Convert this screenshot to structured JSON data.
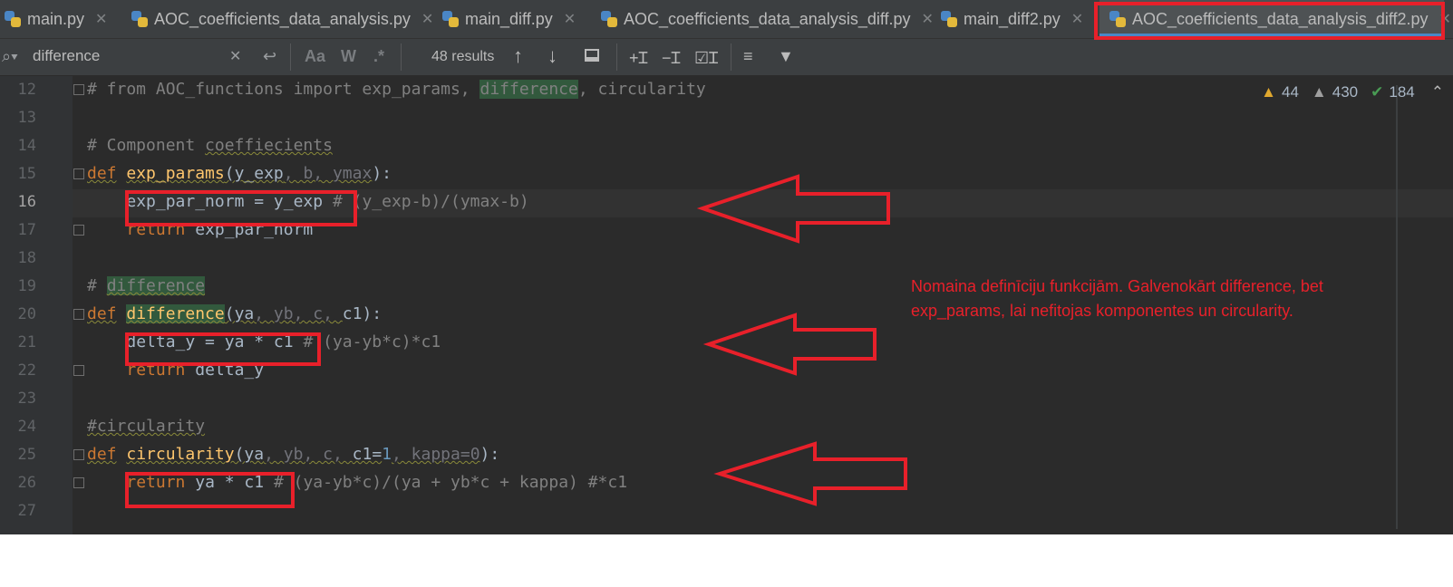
{
  "tabs": [
    {
      "label": "main.py",
      "active": false
    },
    {
      "label": "AOC_coefficients_data_analysis.py",
      "active": false
    },
    {
      "label": "main_diff.py",
      "active": false
    },
    {
      "label": "AOC_coefficients_data_analysis_diff.py",
      "active": false
    },
    {
      "label": "main_diff2.py",
      "active": false
    },
    {
      "label": "AOC_coefficients_data_analysis_diff2.py",
      "active": true
    }
  ],
  "search": {
    "query": "difference",
    "results": "48 results",
    "match_case": "Aa",
    "words": "W",
    "regex": ".*"
  },
  "inspections": {
    "warnings": "44",
    "weak_warnings": "430",
    "typos": "184"
  },
  "line_numbers": [
    "12",
    "13",
    "14",
    "15",
    "16",
    "17",
    "18",
    "19",
    "20",
    "21",
    "22",
    "23",
    "24",
    "25",
    "26",
    "27"
  ],
  "current_line": "16",
  "code": {
    "l12": {
      "a": "# from AOC_functions import exp_params, ",
      "b": "difference",
      "c": ", circularity"
    },
    "l14": {
      "a": "# Component ",
      "b": "coeffiecients"
    },
    "l15": {
      "kw": "def",
      "fn": "exp_params",
      "a": "(y_exp",
      "b": ", b, ymax",
      "c": "):"
    },
    "l16": {
      "a": "exp_par_norm = y_exp",
      "cm": "# (y_exp-b)/(ymax-b)"
    },
    "l17": {
      "kw": "return",
      "a": " exp_par_norm"
    },
    "l19": {
      "a": "# ",
      "b": "difference"
    },
    "l20": {
      "kw": "def",
      "fn": "difference",
      "a": "(ya",
      "b": ", yb, c, ",
      "c": "c1):"
    },
    "l21": {
      "a": "delta_y = ya * c1",
      "cm": "# (ya-yb*c)*c1"
    },
    "l22": {
      "kw": "return",
      "a": " delta_y"
    },
    "l24": {
      "a": "#circularity"
    },
    "l25": {
      "kw": "def",
      "fn": "circularity",
      "a": "(ya",
      "b": ", yb, c, ",
      "c": "c1=",
      "num": "1",
      "d": ", kappa=0",
      "e": "):"
    },
    "l26": {
      "kw": "return",
      "a": " ya * c1",
      "cm": "# (ya-yb*c)/(ya + yb*c + kappa) #*c1"
    }
  },
  "annotation": {
    "text": "Nomaina definīciju funkcijām. Galvenokārt difference, bet exp_params, lai nefitojas komponentes un circularity.",
    "color": "#e8202a"
  },
  "colors": {
    "keyword": "#cc7832",
    "function": "#ffc66d",
    "comment": "#808080",
    "match_highlight": "#32593d",
    "annotation_red": "#e8202a"
  }
}
